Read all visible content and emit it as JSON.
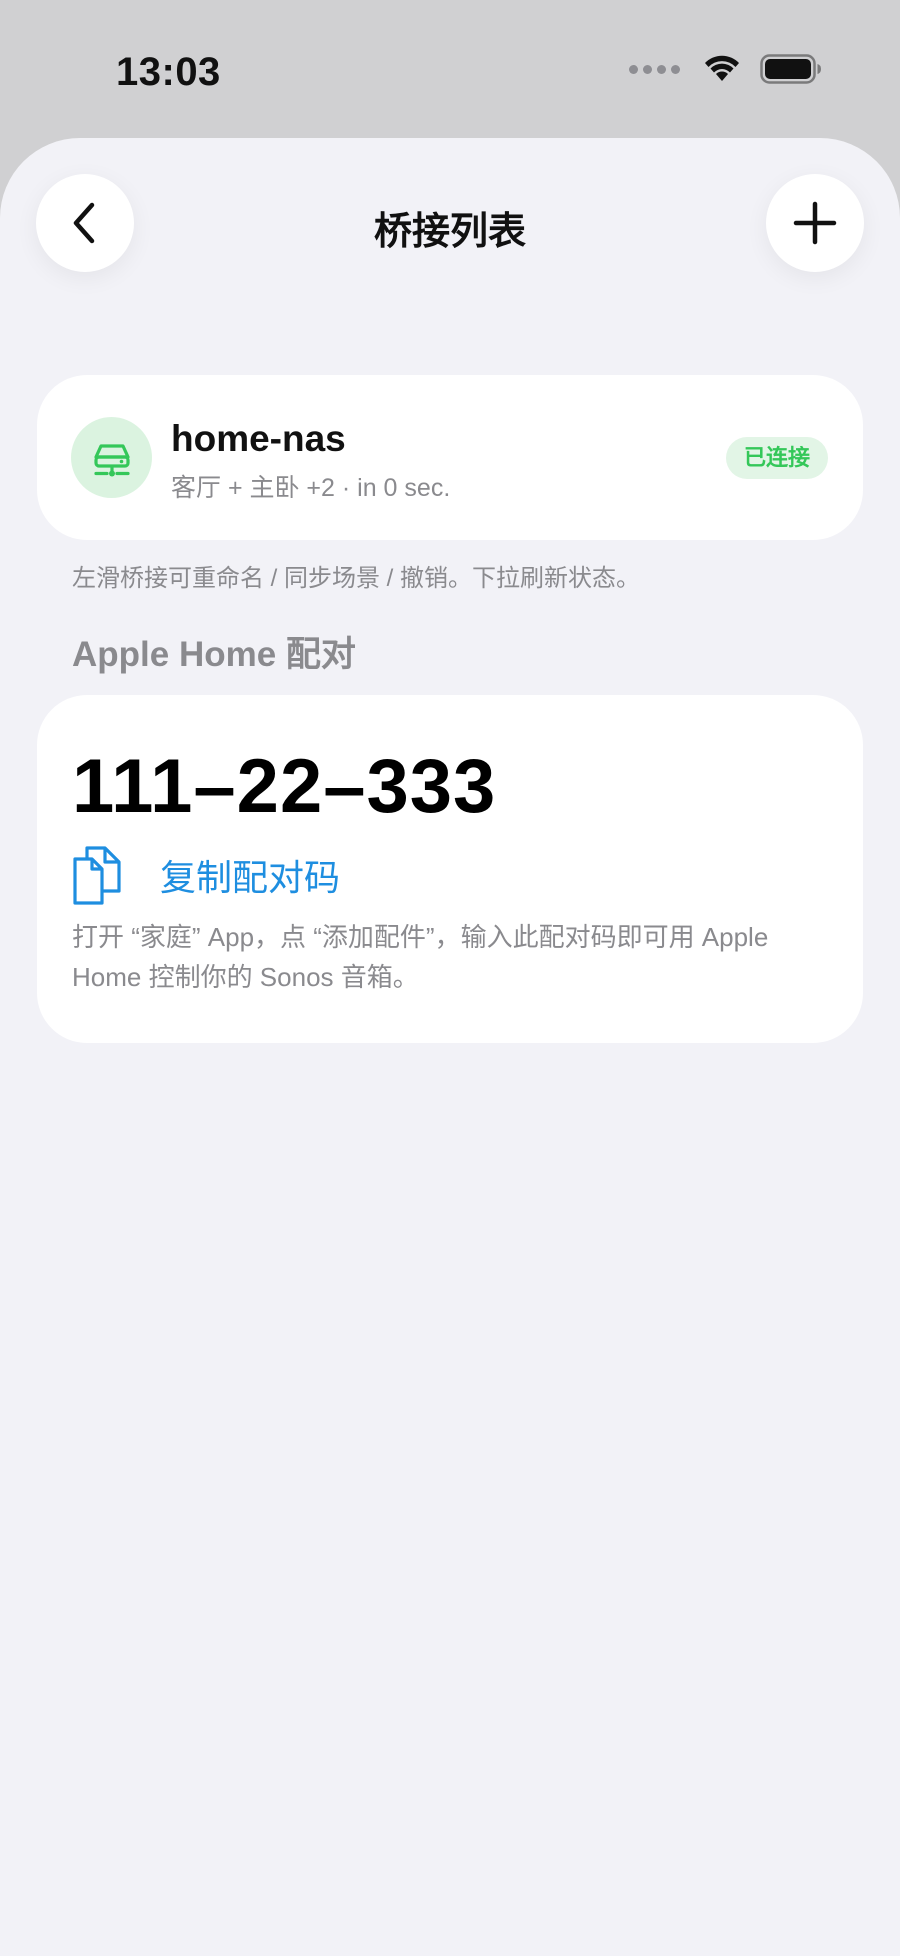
{
  "status_bar": {
    "time": "13:03"
  },
  "nav": {
    "title": "桥接列表",
    "back_icon": "chevron-left-icon",
    "add_icon": "plus-icon"
  },
  "bridge": {
    "name": "home-nas",
    "subtitle": "客厅 + 主卧  +2 · in 0 sec.",
    "status": "已连接",
    "icon": "server-icon"
  },
  "hint": "左滑桥接可重命名 / 同步场景 / 撤销。下拉刷新状态。",
  "pairing": {
    "section_title": "Apple Home 配对",
    "code": "111–22–333",
    "copy_label": "复制配对码",
    "description": "打开 “家庭” App，点 “添加配件”，输入此配对码即可用 Apple Home 控制你的 Sonos 音箱。"
  },
  "colors": {
    "accent": "#1e8ee0",
    "success": "#34c759",
    "background": "#f2f2f7"
  }
}
